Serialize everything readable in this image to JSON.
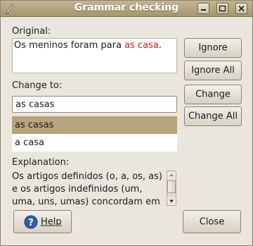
{
  "window": {
    "title": "Grammar checking",
    "controls": [
      "minimize-icon",
      "maximize-icon",
      "close-icon"
    ]
  },
  "original": {
    "label": "Original:",
    "text_before": "Os meninos foram para ",
    "error_text": "as casa",
    "text_after": ".",
    "error_color": "#d01b1b"
  },
  "change_to": {
    "label": "Change to:",
    "value": "as casas"
  },
  "suggestions": {
    "items": [
      "as casas",
      "a casa"
    ],
    "selected_index": 0,
    "selected_color": "#b7a47c"
  },
  "explanation": {
    "label": "Explanation:",
    "lines": [
      "Os artigos definidos (o, a, os, as)",
      "e os artigos indefinidos (um,",
      "uma, uns, umas) concordam em"
    ]
  },
  "buttons": {
    "ignore": "Ignore",
    "ignore_all": "Ignore All",
    "change": "Change",
    "change_all": "Change All",
    "help": "Help",
    "close": "Close"
  }
}
